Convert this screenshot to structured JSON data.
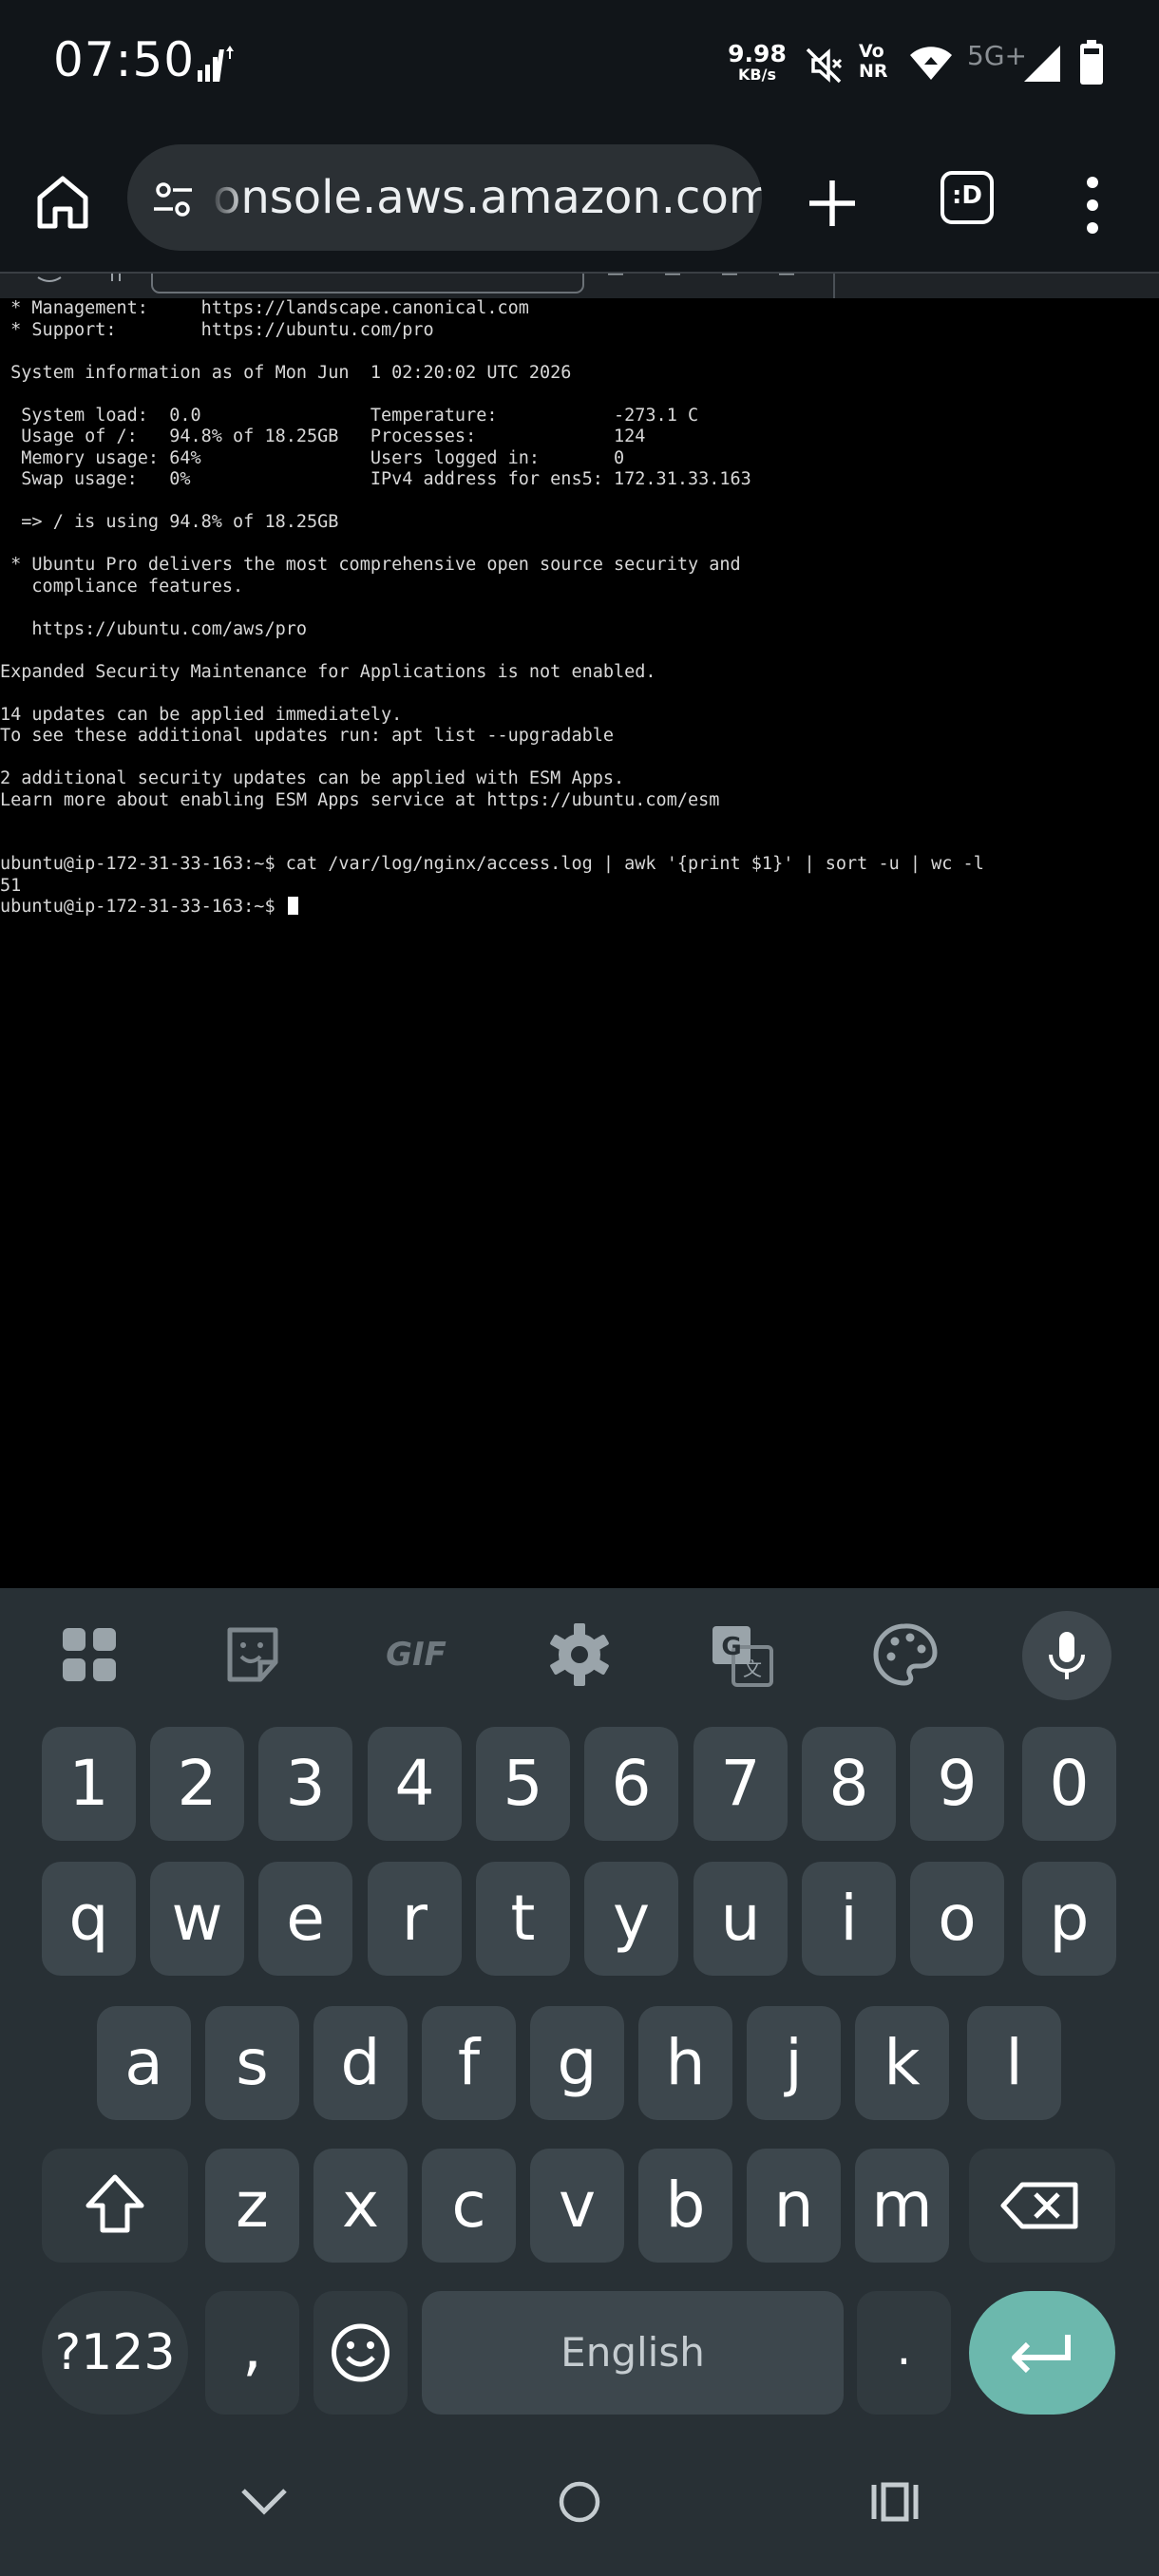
{
  "status_bar": {
    "time": "07:50",
    "speed_value": "9.98",
    "speed_unit": "KB/s",
    "volte_top": "Vo",
    "volte_bottom": "NR",
    "network": "5G+",
    "icons": [
      "signal-activity-icon",
      "mute-icon",
      "volte-icon",
      "wifi-icon",
      "cell-signal-icon",
      "battery-icon"
    ]
  },
  "browser": {
    "url": "onsole.aws.amazon.com",
    "tabs_label": ":D",
    "icons": [
      "home-icon",
      "site-settings-icon",
      "new-tab-icon",
      "tab-switcher-icon",
      "menu-icon"
    ]
  },
  "terminal": {
    "lines": [
      " * Management:     https://landscape.canonical.com",
      " * Support:        https://ubuntu.com/pro",
      "",
      " System information as of Mon Jun  1 02:20:02 UTC 2026",
      "",
      "  System load:  0.0                Temperature:           -273.1 C",
      "  Usage of /:   94.8% of 18.25GB   Processes:             124",
      "  Memory usage: 64%                Users logged in:       0",
      "  Swap usage:   0%                 IPv4 address for ens5: 172.31.33.163",
      "",
      "  => / is using 94.8% of 18.25GB",
      "",
      " * Ubuntu Pro delivers the most comprehensive open source security and",
      "   compliance features.",
      "",
      "   https://ubuntu.com/aws/pro",
      "",
      "Expanded Security Maintenance for Applications is not enabled.",
      "",
      "14 updates can be applied immediately.",
      "To see these additional updates run: apt list --upgradable",
      "",
      "2 additional security updates can be applied with ESM Apps.",
      "Learn more about enabling ESM Apps service at https://ubuntu.com/esm",
      "",
      "",
      "ubuntu@ip-172-31-33-163:~$ cat /var/log/nginx/access.log | awk '{print $1}' | sort -u | wc -l",
      "51"
    ],
    "prompt": "ubuntu@ip-172-31-33-163:~$ "
  },
  "keyboard": {
    "toolbar": [
      "apps-icon",
      "sticker-icon",
      "gif-icon",
      "settings-icon",
      "translate-icon",
      "palette-icon",
      "mic-icon"
    ],
    "gif_label": "GIF",
    "number_row": [
      "1",
      "2",
      "3",
      "4",
      "5",
      "6",
      "7",
      "8",
      "9",
      "0"
    ],
    "row1": [
      "q",
      "w",
      "e",
      "r",
      "t",
      "y",
      "u",
      "i",
      "o",
      "p"
    ],
    "row2": [
      "a",
      "s",
      "d",
      "f",
      "g",
      "h",
      "j",
      "k",
      "l"
    ],
    "row3": [
      "z",
      "x",
      "c",
      "v",
      "b",
      "n",
      "m"
    ],
    "symbols_label": "?123",
    "comma": ",",
    "space_label": "English",
    "period": ".",
    "nav": [
      "nav-back-icon",
      "nav-home-icon",
      "nav-recents-icon"
    ]
  },
  "colors": {
    "status_bg": "#111519",
    "url_bg": "#2b3034",
    "keyboard_bg": "#283035",
    "key_bg": "#3d474d",
    "enter_bg": "#6cb8ad",
    "terminal_text": "#d8d8d8"
  }
}
